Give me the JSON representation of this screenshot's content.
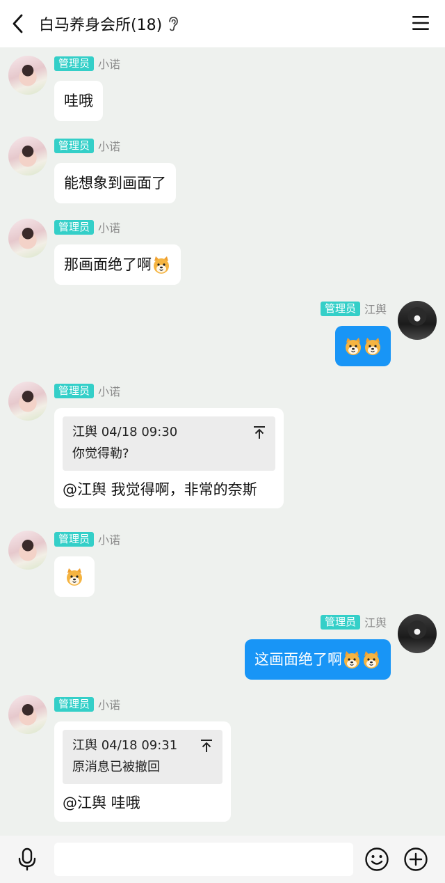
{
  "header": {
    "title": "白马养身会所(18)",
    "back_icon": "chevron-left-icon",
    "ear_icon": "ear-icon",
    "menu_icon": "menu-icon"
  },
  "messages": [
    {
      "side": "left",
      "badge": "管理员",
      "nick": "小诺",
      "text": "哇哦"
    },
    {
      "side": "left",
      "badge": "管理员",
      "nick": "小诺",
      "text": "能想象到画面了"
    },
    {
      "side": "left",
      "badge": "管理员",
      "nick": "小诺",
      "text": "那画面绝了啊",
      "emojis": 1
    },
    {
      "side": "right",
      "badge": "管理员",
      "nick": "江舆",
      "text": "",
      "emojis": 2
    },
    {
      "side": "left",
      "badge": "管理员",
      "nick": "小诺",
      "quote": {
        "author_time": "江舆 04/18 09:30",
        "text": "你觉得勒?"
      },
      "text": "@江舆 我觉得啊，非常的奈斯"
    },
    {
      "side": "left",
      "badge": "管理员",
      "nick": "小诺",
      "text": "",
      "emojis": 1
    },
    {
      "side": "right",
      "badge": "管理员",
      "nick": "江舆",
      "text": "这画面绝了啊",
      "emojis": 2
    },
    {
      "side": "left",
      "badge": "管理员",
      "nick": "小诺",
      "quote": {
        "author_time": "江舆 04/18 09:31",
        "text": "原消息已被撤回"
      },
      "text": "@江舆 哇哦"
    }
  ],
  "bottombar": {
    "input_value": "",
    "mic_icon": "microphone-icon",
    "emoji_icon": "smiley-icon",
    "plus_icon": "plus-circle-icon"
  },
  "colors": {
    "background": "#eef1ee",
    "badge": "#34cfc8",
    "self_bubble": "#1895f6",
    "other_bubble": "#ffffff"
  }
}
